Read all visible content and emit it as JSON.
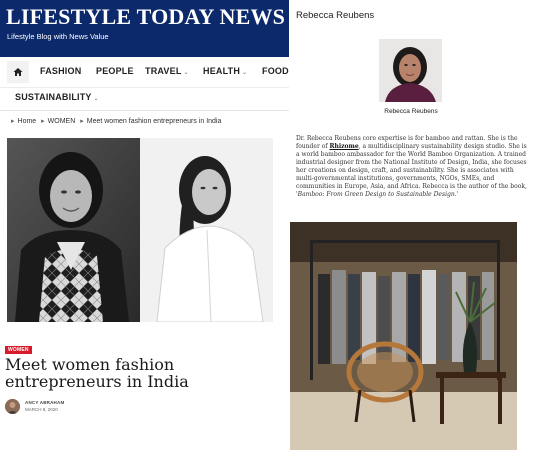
{
  "site": {
    "title": "LIFESTYLE TODAY NEWS",
    "tagline": "Lifestyle Blog with News Value"
  },
  "nav": {
    "home_icon": "home-icon",
    "items": [
      {
        "label": "FASHION"
      },
      {
        "label": "PEOPLE"
      },
      {
        "label": "TRAVEL",
        "has_dropdown": true
      },
      {
        "label": "HEALTH",
        "has_dropdown": true
      },
      {
        "label": "FOOD",
        "has_dropdown": true
      },
      {
        "label": "SUSTAINABILITY",
        "has_dropdown": true
      }
    ]
  },
  "breadcrumb": {
    "items": [
      "Home",
      "WOMEN",
      "Meet women fashion entrepreneurs in India"
    ]
  },
  "article": {
    "category": "WOMEN",
    "title": "Meet women fashion entrepreneurs in India",
    "author": "ANCY ABRAHAM",
    "date": "MARCH 8, 2020"
  },
  "profile": {
    "name": "Rebecca Reubens",
    "caption": "Rebecca Reubens",
    "bio": {
      "part1": "Dr. Rebecca Reubens core expertise is for bamboo and rattan. She is the founder of ",
      "link": "Rhizome",
      "part2": ", a multidisciplinary sustainability design studio. She is a world bamboo ambassador for the World Bamboo Organization. A trained industrial designer from the National Institute of Design, India, she focuses her creations on design, craft, and sustainability. She is associates with multi-governmental institutions, governments, NGOs, SMEs, and communities in Europe, Asia, and Africa. Rebecca is the author of the book, '",
      "book": "Bamboo: From Green Design to Sustainable Design.",
      "part3": "'"
    }
  },
  "colors": {
    "header_bg": "#0c2a6b",
    "badge": "#d81b2a"
  }
}
